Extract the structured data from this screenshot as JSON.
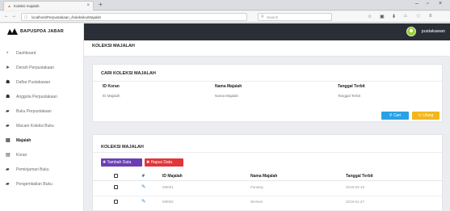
{
  "browser": {
    "tab_title": "Koleksi majalah",
    "tab_close": "×",
    "new_tab": "+",
    "url": "localhost/Perpustakaan_/koleksiku/Majalah",
    "search_placeholder": "Search",
    "window_controls": [
      "–",
      "▫",
      "×"
    ]
  },
  "sidebar": {
    "brand": "BAPUSPDA JABAR",
    "items": [
      {
        "label": "Dashboard",
        "icon": "dashboard-icon",
        "glyph": "◔"
      },
      {
        "label": "Denah Perpustakaan",
        "icon": "location-icon",
        "glyph": "➤"
      },
      {
        "label": "Daftar Pustakawan",
        "icon": "user-icon",
        "glyph": "☗"
      },
      {
        "label": "Anggota Perpustakaan",
        "icon": "users-icon",
        "glyph": "☗"
      },
      {
        "label": "Buku Perpustakaan",
        "icon": "book-icon",
        "glyph": "▰"
      },
      {
        "label": "Macam Koleksi Buku",
        "icon": "book-icon",
        "glyph": "▰"
      },
      {
        "label": "Majalah",
        "icon": "magazine-icon",
        "glyph": "▤"
      },
      {
        "label": "Koran",
        "icon": "newspaper-icon",
        "glyph": "▤"
      },
      {
        "label": "Peminjaman Buku",
        "icon": "book-icon",
        "glyph": "▰"
      },
      {
        "label": "Pengembalian Buku",
        "icon": "book-icon",
        "glyph": "▰"
      }
    ],
    "active_index": 6
  },
  "topbar": {
    "username": "pustakawan"
  },
  "page": {
    "title": "KOLEKSI MAJALAH"
  },
  "search_card": {
    "title": "CARI KOLEKSI MAJALAH",
    "fields": [
      {
        "label": "ID Koran",
        "placeholder": "ID Majalah"
      },
      {
        "label": "Nama Majalah",
        "placeholder": "Nama Majalah"
      },
      {
        "label": "Tanggal Terbit",
        "placeholder": "Tanggal Terbit"
      }
    ],
    "search_button": "Cari",
    "reset_button": "Ulang",
    "accent_blue": "#2aa1e6",
    "accent_yellow": "#f3b61c"
  },
  "table_card": {
    "title": "KOLEKSI MAJALAH",
    "add_button": "Tambah Data",
    "delete_button": "Hapus Data",
    "columns": [
      "#",
      "ID Majalah",
      "Nama Majalah",
      "Tanggal Terbit"
    ],
    "rows": [
      {
        "id": "M0001",
        "nama": "Fantasy",
        "tanggal": "2019-03-19"
      },
      {
        "id": "M0002",
        "nama": "Women",
        "tanggal": "2019-01-27"
      }
    ],
    "add_color": "#6b3fb4",
    "delete_color": "#e0363a"
  }
}
